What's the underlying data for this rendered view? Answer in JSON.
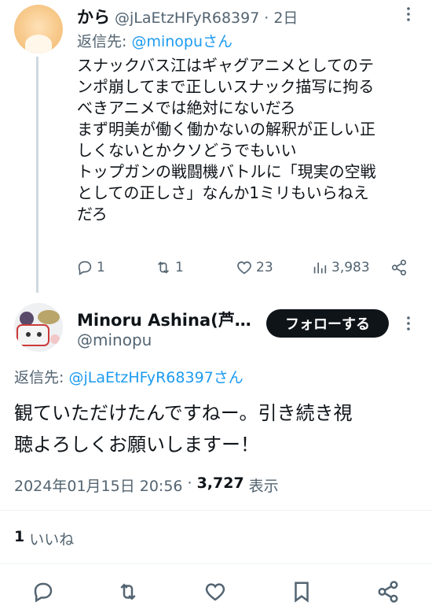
{
  "tweet1": {
    "display_name": "から",
    "handle": "@jLaEtzHFyR68397",
    "separator": "·",
    "time": "2日",
    "reply_prefix": "返信先:",
    "reply_to": "@minopuさん",
    "lines": [
      "スナックバス江はギャグアニメとしてのテ",
      "ンポ崩してまで正しいスナック描写に拘る",
      "べきアニメでは絶対にないだろ",
      "まず明美が働く働かないの解釈が正しい正",
      "しくないとかクソどうでもいい",
      "トップガンの戦闘機バトルに「現実の空戦",
      "としての正しさ」なんか1ミリもいらねえ",
      "だろ"
    ],
    "stats": {
      "replies": "1",
      "retweets": "1",
      "likes": "23",
      "views": "3,983"
    }
  },
  "tweet2": {
    "display_name": "Minoru Ashina(芦…",
    "handle": "@minopu",
    "follow_label": "フォローする",
    "reply_prefix": "返信先:",
    "reply_to": "@jLaEtzHFyR68397さん",
    "lines": [
      "観ていただけたんですねー。引き続き視",
      "聴よろしくお願いしますー！"
    ],
    "timestamp": "2024年01月15日 20:56",
    "separator": "·",
    "views_count": "3,727",
    "views_label": "表示",
    "likes_count": "1",
    "likes_label": "いいね"
  },
  "colors": {
    "accent": "#1d9bf0",
    "text": "#0f1419",
    "muted": "#536471",
    "divider": "#eff3f4"
  },
  "icons": [
    "reply-icon",
    "retweet-icon",
    "like-icon",
    "views-icon",
    "share-icon",
    "more-icon",
    "bookmark-icon"
  ]
}
